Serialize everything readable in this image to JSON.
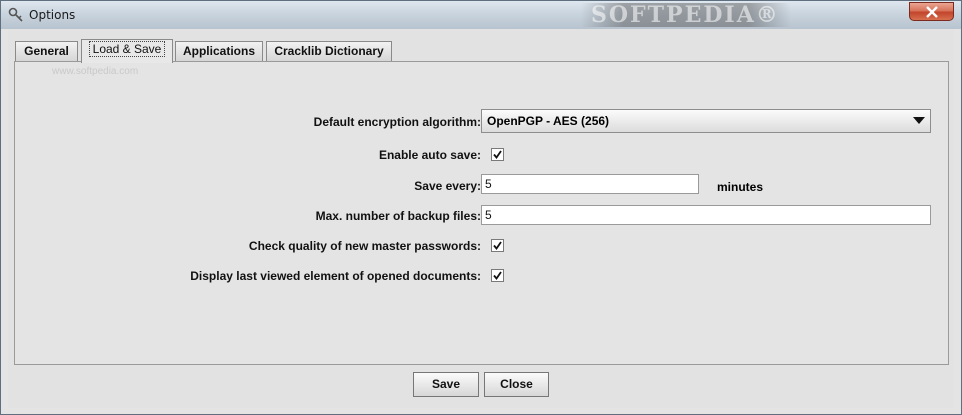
{
  "window": {
    "title": "Options",
    "watermark": "SOFTPEDIA®"
  },
  "tabs": [
    {
      "label": "General",
      "active": false
    },
    {
      "label": "Load & Save",
      "active": true
    },
    {
      "label": "Applications",
      "active": false
    },
    {
      "label": "Cracklib Dictionary",
      "active": false
    }
  ],
  "panel_watermark": "www.softpedia.com",
  "form": {
    "encryption_label": "Default encryption algorithm:",
    "encryption_value": "OpenPGP - AES (256)",
    "autosave_label": "Enable auto save:",
    "autosave_checked": true,
    "save_every_label": "Save every:",
    "save_every_value": "5",
    "save_every_unit": "minutes",
    "backup_label": "Max. number of backup files:",
    "backup_value": "5",
    "quality_label": "Check quality of new master passwords:",
    "quality_checked": true,
    "last_viewed_label": "Display last viewed element of opened documents:",
    "last_viewed_checked": true
  },
  "buttons": {
    "save": "Save",
    "close": "Close"
  },
  "icons": {
    "title": "key-icon",
    "close": "close-icon",
    "check": "checkmark-icon",
    "dropdown": "chevron-down-icon"
  }
}
